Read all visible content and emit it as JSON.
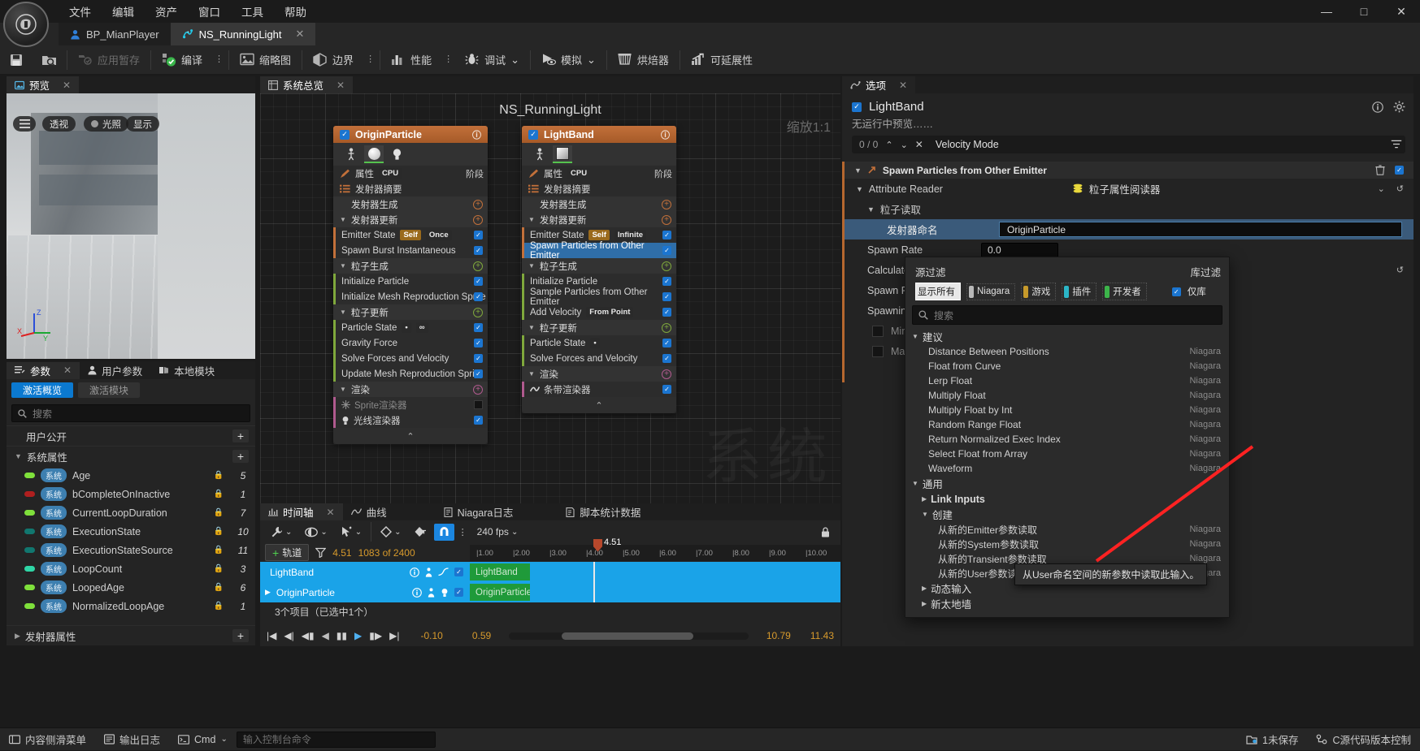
{
  "window": {
    "menus": [
      "文件",
      "编辑",
      "资产",
      "窗口",
      "工具",
      "帮助"
    ],
    "minimize": "—",
    "maximize": "□",
    "close": "✕"
  },
  "tabs": [
    {
      "label": "BP_MianPlayer",
      "icon": "person-icon",
      "active": false
    },
    {
      "label": "NS_RunningLight",
      "icon": "niagara-icon",
      "active": true,
      "close": "✕"
    }
  ],
  "toolbar": {
    "save": "",
    "browse": "",
    "apply_label": "应用暂存",
    "compile_label": "编译",
    "thumbnail_label": "缩略图",
    "bounds_label": "边界",
    "performance_label": "性能",
    "debug_label": "调试",
    "simulate_label": "模拟",
    "baker_label": "烘焙器",
    "scalability_label": "可延展性",
    "dots": "⋮",
    "caret": "⌄"
  },
  "preview": {
    "tab_label": "预览",
    "close": "✕",
    "buttons": [
      "透视",
      "光照",
      "显示"
    ],
    "menu_icon": "hamburger-icon",
    "axis": {
      "x": "X",
      "y": "Y",
      "z": "Z"
    }
  },
  "parameters": {
    "tabs": [
      {
        "label": "参数",
        "icon": "parameters-icon",
        "active": true,
        "close": "✕"
      },
      {
        "label": "用户参数",
        "icon": "user-icon",
        "active": false
      },
      {
        "label": "本地模块",
        "icon": "module-icon",
        "active": false
      }
    ],
    "toggles": [
      {
        "label": "激活概览",
        "on": true
      },
      {
        "label": "激活模块",
        "on": false
      }
    ],
    "search_placeholder": "搜索",
    "sections": [
      {
        "label": "用户公开",
        "collapsed": true,
        "add": "+"
      },
      {
        "label": "系统属性",
        "collapsed": false,
        "add": "+"
      }
    ],
    "rows": [
      {
        "scope": "系统",
        "name": "Age",
        "value": "5",
        "dot": "#7fe03b",
        "locked": true
      },
      {
        "scope": "系统",
        "name": "bCompleteOnInactive",
        "value": "1",
        "dot": "#b01f1f",
        "locked": true
      },
      {
        "scope": "系统",
        "name": "CurrentLoopDuration",
        "value": "7",
        "dot": "#7fe03b",
        "locked": true
      },
      {
        "scope": "系统",
        "name": "ExecutionState",
        "value": "10",
        "dot": "#11776f",
        "locked": true
      },
      {
        "scope": "系统",
        "name": "ExecutionStateSource",
        "value": "11",
        "dot": "#11776f",
        "locked": true
      },
      {
        "scope": "系统",
        "name": "LoopCount",
        "value": "3",
        "dot": "#2fd6a6",
        "locked": true
      },
      {
        "scope": "系统",
        "name": "LoopedAge",
        "value": "6",
        "dot": "#7fe03b",
        "locked": true
      },
      {
        "scope": "系统",
        "name": "NormalizedLoopAge",
        "value": "1",
        "dot": "#7fe03b",
        "locked": true
      }
    ],
    "footer_section": {
      "label": "发射器属性",
      "add": "+"
    }
  },
  "system_overview": {
    "tab_label": "系统总览",
    "close": "✕",
    "graph_title": "NS_RunningLight",
    "zoom_label": "缩放1:1",
    "watermark": "系统",
    "emitters": [
      {
        "name": "OriginParticle",
        "enabled": true,
        "info_icon": "info-icon",
        "thumbs": [
          "person-icon",
          "sphere-icon",
          "light-icon"
        ],
        "selected_thumb": 1,
        "rows": [
          {
            "type": "prop",
            "label": "属性",
            "chip": "CPU",
            "icon": "pencil-icon",
            "right": "阶段"
          },
          {
            "type": "prop",
            "label": "发射器摘要",
            "icon": "list-icon"
          },
          {
            "type": "section",
            "label": "发射器生成",
            "add": "+",
            "color": "#c2703a"
          },
          {
            "type": "section",
            "label": "发射器更新",
            "add": "+",
            "color": "#c2703a",
            "expanded": true
          },
          {
            "type": "module",
            "label": "Emitter State",
            "chips": [
              "Self",
              "Once"
            ],
            "checked": true,
            "bar": "#c2703a"
          },
          {
            "type": "module",
            "label": "Spawn Burst Instantaneous",
            "checked": true,
            "bar": "#c2703a"
          },
          {
            "type": "section",
            "label": "粒子生成",
            "add": "+",
            "color": "#7fa83c",
            "expanded": true
          },
          {
            "type": "module",
            "label": "Initialize Particle",
            "checked": true,
            "bar": "#7fa83c"
          },
          {
            "type": "module",
            "label": "Initialize Mesh Reproduction Sprite",
            "checked": true,
            "bar": "#7fa83c"
          },
          {
            "type": "section",
            "label": "粒子更新",
            "add": "+",
            "color": "#7fa83c",
            "expanded": true
          },
          {
            "type": "module",
            "label": "Particle State",
            "chips": [
              "•",
              "∞"
            ],
            "checked": true,
            "bar": "#7fa83c"
          },
          {
            "type": "module",
            "label": "Gravity Force",
            "checked": true,
            "bar": "#7fa83c"
          },
          {
            "type": "module",
            "label": "Solve Forces and Velocity",
            "checked": true,
            "bar": "#7fa83c"
          },
          {
            "type": "module",
            "label": "Update Mesh Reproduction Sprite",
            "checked": true,
            "bar": "#7fa83c"
          },
          {
            "type": "section",
            "label": "渲染",
            "add": "+",
            "color": "#b05a8e",
            "expanded": true
          },
          {
            "type": "module",
            "label": "Sprite渲染器",
            "checked": false,
            "disabled": true,
            "icon": "sprite-icon",
            "bar": "#b05a8e"
          },
          {
            "type": "module",
            "label": "光线渲染器",
            "checked": true,
            "icon": "light-icon",
            "bar": "#b05a8e"
          }
        ]
      },
      {
        "name": "LightBand",
        "enabled": true,
        "info_icon": "info-icon",
        "thumbs": [
          "person-icon",
          "band-icon"
        ],
        "selected_thumb": 1,
        "rows": [
          {
            "type": "prop",
            "label": "属性",
            "chip": "CPU",
            "icon": "pencil-icon",
            "right": "阶段"
          },
          {
            "type": "prop",
            "label": "发射器摘要",
            "icon": "list-icon"
          },
          {
            "type": "section",
            "label": "发射器生成",
            "add": "+",
            "color": "#c2703a"
          },
          {
            "type": "section",
            "label": "发射器更新",
            "add": "+",
            "color": "#c2703a",
            "expanded": true
          },
          {
            "type": "module",
            "label": "Emitter State",
            "chips": [
              "Self",
              "Infinite"
            ],
            "checked": true,
            "bar": "#c2703a"
          },
          {
            "type": "module",
            "label": "Spawn Particles from Other Emitter",
            "checked": true,
            "selected": true,
            "bar": "#c2703a"
          },
          {
            "type": "section",
            "label": "粒子生成",
            "add": "+",
            "color": "#7fa83c",
            "expanded": true
          },
          {
            "type": "module",
            "label": "Initialize Particle",
            "checked": true,
            "bar": "#7fa83c"
          },
          {
            "type": "module",
            "label": "Sample Particles from Other Emitter",
            "checked": true,
            "bar": "#7fa83c"
          },
          {
            "type": "module",
            "label": "Add Velocity",
            "chips": [
              "From Point"
            ],
            "checked": true,
            "bar": "#7fa83c"
          },
          {
            "type": "section",
            "label": "粒子更新",
            "add": "+",
            "color": "#7fa83c",
            "expanded": true
          },
          {
            "type": "module",
            "label": "Particle State",
            "chips": [
              "•"
            ],
            "checked": true,
            "bar": "#7fa83c"
          },
          {
            "type": "module",
            "label": "Solve Forces and Velocity",
            "checked": true,
            "bar": "#7fa83c"
          },
          {
            "type": "section",
            "label": "渲染",
            "add": "+",
            "color": "#b05a8e",
            "expanded": true
          },
          {
            "type": "module",
            "label": "条带渲染器",
            "checked": true,
            "icon": "ribbon-icon",
            "bar": "#b05a8e"
          }
        ]
      }
    ],
    "collapse_caret": "⌃"
  },
  "timeline": {
    "tabs": [
      {
        "label": "时间轴",
        "icon": "timeline-icon",
        "active": true,
        "close": "✕"
      },
      {
        "label": "曲线",
        "icon": "curve-icon",
        "active": false
      },
      {
        "label": "Niagara日志",
        "icon": "log-icon",
        "active": false
      },
      {
        "label": "脚本统计数据",
        "icon": "stats-icon",
        "active": false
      }
    ],
    "toolbar": {
      "wrench": "wrench-icon",
      "eye": "eye-icon",
      "pointer": "pointer-icon",
      "diamond": "diamond-icon",
      "key": "key-icon",
      "magnet": "magnet-icon",
      "dots": "⋮",
      "fps": "240 fps",
      "caret": "⌄"
    },
    "add_track_label": "轨道",
    "add_track_plus": "+",
    "filter_icon": "filter-icon",
    "current_time": "4.51",
    "frame_counter": "1083 of 2400",
    "playhead_label": "4.51",
    "ruler_ticks": [
      "1.00",
      "2.00",
      "3.00",
      "4.00",
      "5.00",
      "6.00",
      "7.00",
      "8.00",
      "9.00",
      "10.00"
    ],
    "tracks": [
      {
        "name": "LightBand",
        "clip": "LightBand",
        "color": "#16a6e8",
        "clip_color": "#1f9a3a",
        "checked": true
      },
      {
        "name": "OriginParticle",
        "clip": "OriginParticle",
        "color": "#16a6e8",
        "clip_color": "#1f9a3a",
        "checked": true
      }
    ],
    "selection_status": "3个项目（已选中1个）",
    "transport": {
      "start": "|◀",
      "prev": "◀|",
      "step_back": "◀▮",
      "reverse": "◀",
      "pause": "▮▮",
      "play": "▶",
      "step": "▮▶",
      "next": "▶|",
      "end": "▶|"
    },
    "range_start": "-0.10",
    "range_in": "0.59",
    "range_out": "10.79",
    "range_end": "11.43",
    "lock_icon": "lock-icon"
  },
  "options": {
    "tab_label": "选项",
    "tab_icon": "niagara-icon",
    "close": "✕",
    "emitter_name": "LightBand",
    "emitter_enabled": true,
    "info_icon": "info-icon",
    "gear_icon": "gear-icon",
    "no_preview_text": "无运行中预览……",
    "search_count": "0 / 0",
    "search_up": "⌃",
    "search_down": "⌄",
    "search_clear": "✕",
    "search_value": "Velocity Mode",
    "filter_icon": "filter-icon",
    "module_header": {
      "label": "Spawn Particles from Other Emitter",
      "icon": "module-arrow-icon",
      "trash": "trash-icon",
      "checked": true
    },
    "rows": [
      {
        "label": "Attribute Reader",
        "value": "粒子属性阅读器",
        "value_icon": "stack-icon",
        "type": "expander",
        "reset": "↺",
        "caret": "⌄"
      },
      {
        "label": "粒子读取",
        "type": "expander2"
      },
      {
        "label": "发射器命名",
        "value": "OriginParticle",
        "type": "text-highlight"
      },
      {
        "label": "Spawn Rate",
        "value": "0.0",
        "type": "num",
        "reset": "↺",
        "caret": "⌄"
      },
      {
        "label": "Calculate S",
        "type": "partial"
      },
      {
        "label": "Spawn Rate",
        "type": "partial"
      },
      {
        "label": "Spawning E",
        "type": "partial"
      },
      {
        "label": "Minimu",
        "type": "checkbox-partial"
      },
      {
        "label": "Maxim",
        "type": "checkbox-partial"
      }
    ]
  },
  "dropdown": {
    "source_filter_label": "源过滤",
    "library_filter_label": "库过滤",
    "filters": [
      {
        "label": "显示所有",
        "color": "",
        "on": true
      },
      {
        "label": "Niagara",
        "color": "#b8b8b8",
        "on": false
      },
      {
        "label": "游戏",
        "color": "#c79a2b",
        "on": false
      },
      {
        "label": "插件",
        "color": "#2bb6c7",
        "on": false
      },
      {
        "label": "开发者",
        "color": "#3cb44a",
        "on": false
      }
    ],
    "library_only": {
      "label": "仅库",
      "checked": true
    },
    "search_placeholder": "搜索",
    "groups": [
      {
        "label": "建议",
        "expanded": true,
        "items": [
          {
            "label": "Distance Between Positions",
            "library": "Niagara"
          },
          {
            "label": "Float from Curve",
            "library": "Niagara"
          },
          {
            "label": "Lerp Float",
            "library": "Niagara"
          },
          {
            "label": "Multiply Float",
            "library": "Niagara"
          },
          {
            "label": "Multiply Float by Int",
            "library": "Niagara"
          },
          {
            "label": "Random Range Float",
            "library": "Niagara"
          },
          {
            "label": "Return Normalized Exec Index",
            "library": "Niagara"
          },
          {
            "label": "Select Float from Array",
            "library": "Niagara"
          },
          {
            "label": "Waveform",
            "library": "Niagara"
          }
        ]
      },
      {
        "label": "通用",
        "expanded": true,
        "items": [],
        "subgroups": [
          {
            "label": "Link Inputs",
            "expanded": false,
            "bold": true,
            "items": []
          },
          {
            "label": "创建",
            "expanded": true,
            "items": [
              {
                "label": "从新的Emitter参数读取",
                "library": "Niagara"
              },
              {
                "label": "从新的System参数读取",
                "library": "Niagara"
              },
              {
                "label": "从新的Transient参数读取",
                "library": "Niagara"
              },
              {
                "label": "从新的User参数读取",
                "library": "Niagara"
              }
            ]
          },
          {
            "label": "动态输入",
            "expanded": false,
            "items": []
          },
          {
            "label": "新太地墙",
            "expanded": false,
            "items": []
          }
        ]
      }
    ],
    "tooltip": "从User命名空间的新参数中读取此输入。"
  },
  "statusbar": {
    "content_drawer": "内容侧滑菜单",
    "output_log": "输出日志",
    "cmd_label": "Cmd",
    "cmd_caret": "⌄",
    "cmd_placeholder": "输入控制台命令",
    "unsaved": "1未保存",
    "revision": "C源代码版本控制"
  },
  "colors": {
    "accent_blue": "#0b79d0",
    "emitter_orange": "#b6672f",
    "particle_green": "#7fa83c",
    "render_pink": "#b05a8e",
    "timeline_blue": "#16a6e8",
    "clip_green": "#1f9a3a",
    "highlight_red": "#ff2d2d"
  }
}
